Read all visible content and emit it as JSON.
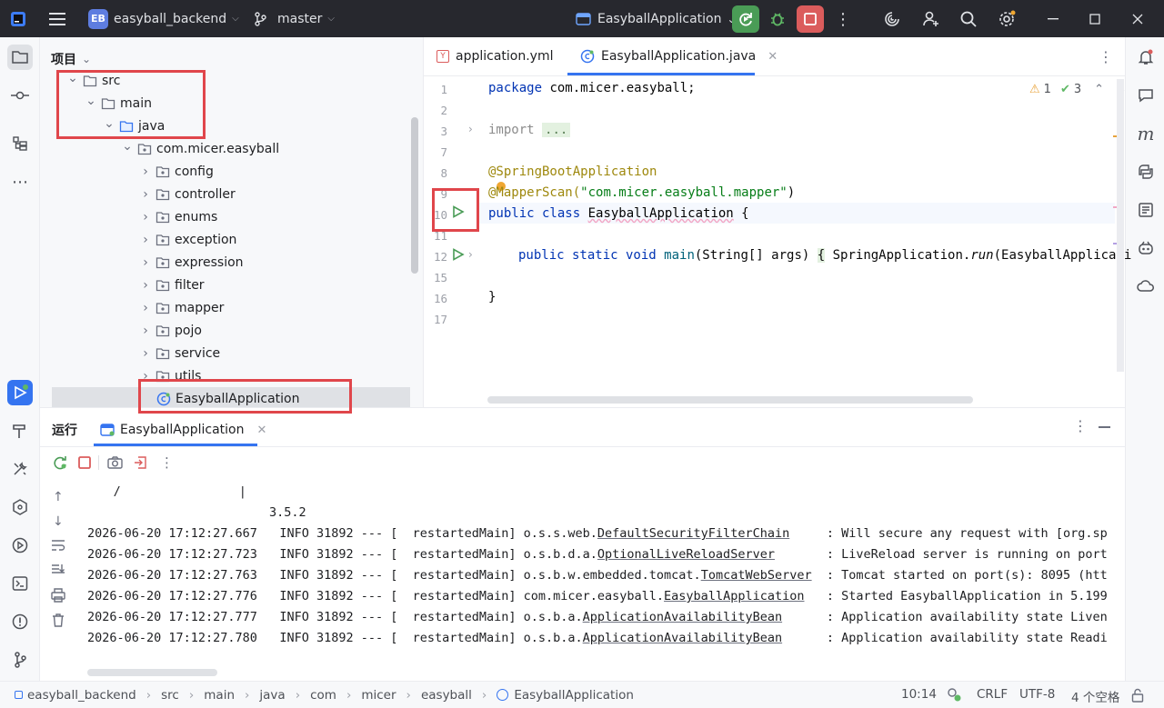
{
  "titlebar": {
    "project_badge": "EB",
    "project_name": "easyball_backend",
    "branch": "master",
    "run_config": "EasyballApplication"
  },
  "project_panel": {
    "title": "项目",
    "tree": [
      {
        "label": "src",
        "level": 0,
        "expanded": true,
        "type": "folder"
      },
      {
        "label": "main",
        "level": 1,
        "expanded": true,
        "type": "folder"
      },
      {
        "label": "java",
        "level": 2,
        "expanded": true,
        "type": "source-folder"
      },
      {
        "label": "com.micer.easyball",
        "level": 3,
        "expanded": true,
        "type": "package"
      },
      {
        "label": "config",
        "level": 4,
        "expanded": false,
        "type": "package"
      },
      {
        "label": "controller",
        "level": 4,
        "expanded": false,
        "type": "package"
      },
      {
        "label": "enums",
        "level": 4,
        "expanded": false,
        "type": "package"
      },
      {
        "label": "exception",
        "level": 4,
        "expanded": false,
        "type": "package"
      },
      {
        "label": "expression",
        "level": 4,
        "expanded": false,
        "type": "package"
      },
      {
        "label": "filter",
        "level": 4,
        "expanded": false,
        "type": "package"
      },
      {
        "label": "mapper",
        "level": 4,
        "expanded": false,
        "type": "package"
      },
      {
        "label": "pojo",
        "level": 4,
        "expanded": false,
        "type": "package"
      },
      {
        "label": "service",
        "level": 4,
        "expanded": false,
        "type": "package"
      },
      {
        "label": "utils",
        "level": 4,
        "expanded": false,
        "type": "package"
      },
      {
        "label": "EasyballApplication",
        "level": 4,
        "expanded": false,
        "type": "class",
        "selected": true
      }
    ]
  },
  "editor": {
    "tabs": [
      {
        "label": "application.yml",
        "active": false
      },
      {
        "label": "EasyballApplication.java",
        "active": true
      }
    ],
    "inspections": {
      "warnings": "1",
      "ok": "3"
    },
    "line_numbers": [
      "1",
      "2",
      "3",
      "7",
      "8",
      "9",
      "10",
      "11",
      "12",
      "15",
      "16",
      "17"
    ],
    "code": {
      "package_kw": "package",
      "package_name": " com.micer.easyball;",
      "import_kw": "import",
      "import_fold": "...",
      "annotation1": "@SpringBootApplication",
      "annotation2_name": "@MapperScan(",
      "annotation2_arg": "\"com.micer.easyball.mapper\"",
      "annotation2_close": ")",
      "class_kw": "public class",
      "class_name": "EasyballApplication",
      "class_open": " {",
      "main_kw": "public static void",
      "main_name": "main",
      "main_params": "(String[] args) ",
      "main_body_open": "{",
      "main_body": " SpringApplication.",
      "main_run": "run",
      "main_arg": "(EasyballApplicati",
      "class_close": "}"
    }
  },
  "run_panel": {
    "title": "运行",
    "tab": "EasyballApplication",
    "banner_line1": "     /                |",
    "banner_version": "3.5.2",
    "log": [
      {
        "ts": "2026-06-20 17:12:27.667",
        "level": "INFO",
        "pid": "31892",
        "sep": "--- [  restartedMain]",
        "pkg": "o.s.s.web.",
        "cls": "DefaultSecurityFilterChain",
        "pad": "     ",
        "msg": ": Will secure any request with [org.sp"
      },
      {
        "ts": "2026-06-20 17:12:27.723",
        "level": "INFO",
        "pid": "31892",
        "sep": "--- [  restartedMain]",
        "pkg": "o.s.b.d.a.",
        "cls": "OptionalLiveReloadServer",
        "pad": "       ",
        "msg": ": LiveReload server is running on port"
      },
      {
        "ts": "2026-06-20 17:12:27.763",
        "level": "INFO",
        "pid": "31892",
        "sep": "--- [  restartedMain]",
        "pkg": "o.s.b.w.embedded.tomcat.",
        "cls": "TomcatWebServer",
        "pad": "  ",
        "msg": ": Tomcat started on port(s): 8095 (htt"
      },
      {
        "ts": "2026-06-20 17:12:27.776",
        "level": "INFO",
        "pid": "31892",
        "sep": "--- [  restartedMain]",
        "pkg": "com.micer.easyball.",
        "cls": "EasyballApplication",
        "pad": "   ",
        "msg": ": Started EasyballApplication in 5.199"
      },
      {
        "ts": "2026-06-20 17:12:27.777",
        "level": "INFO",
        "pid": "31892",
        "sep": "--- [  restartedMain]",
        "pkg": "o.s.b.a.",
        "cls": "ApplicationAvailabilityBean",
        "pad": "      ",
        "msg": ": Application availability state Liven"
      },
      {
        "ts": "2026-06-20 17:12:27.780",
        "level": "INFO",
        "pid": "31892",
        "sep": "--- [  restartedMain]",
        "pkg": "o.s.b.a.",
        "cls": "ApplicationAvailabilityBean",
        "pad": "      ",
        "msg": ": Application availability state Readi"
      }
    ]
  },
  "statusbar": {
    "breadcrumb": [
      "easyball_backend",
      "src",
      "main",
      "java",
      "com",
      "micer",
      "easyball",
      "EasyballApplication"
    ],
    "position": "10:14",
    "line_sep": "CRLF",
    "encoding": "UTF-8",
    "indent": "4 个空格"
  },
  "colors": {
    "accent": "#3574f0",
    "highlight_box": "#e0464b",
    "run_green": "#4a9c56",
    "stop_red": "#db5c5c"
  }
}
